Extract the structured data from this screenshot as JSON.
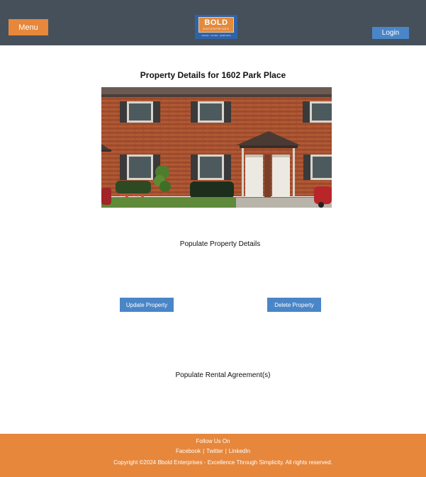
{
  "header": {
    "menu_label": "Menu",
    "login_label": "Login",
    "logo": {
      "word": "BOLD",
      "sub": "ENTERPRISES",
      "tagline": "Houses · Condos · Apartments",
      "colors": {
        "background": "#2f63a8",
        "plate": "#e38a3b"
      }
    },
    "background_color": "#45505b"
  },
  "main": {
    "title": "Property Details for 1602 Park Place",
    "photo_icon": "property-photo",
    "details_placeholder": "Populate Property Details",
    "update_label": "Update Property",
    "delete_label": "Delete Property",
    "rental_placeholder": "Populate Rental Agreement(s)"
  },
  "footer": {
    "follow_label": "Follow Us On",
    "links": [
      "Facebook",
      "Twitter",
      "LinkedIn"
    ],
    "separator": "|",
    "copyright": "Copyright ©2024 Bbold Enterprises - Excellence Through Simplicity. All rights reserved.",
    "background_color": "#e6873c"
  },
  "colors": {
    "accent_orange": "#e6873c",
    "accent_blue": "#4a86c7"
  }
}
